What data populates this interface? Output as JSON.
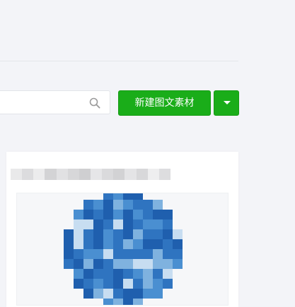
{
  "toolbar": {
    "search_value": "",
    "search_placeholder": "",
    "create_button_label": "新建图文素材",
    "dropdown_icon": "caret-down-icon",
    "search_icon": "magnifier-icon"
  },
  "colors": {
    "primary": "#1aad19",
    "page_background": "#f3f4f8",
    "card_background": "#ffffff",
    "mosaic_blues": [
      "#1f5fae",
      "#2f74c0",
      "#4a8fd1",
      "#7fb2df",
      "#c7ddf1"
    ]
  },
  "material_card": {
    "title_obscured": true,
    "cover_obscured": true
  }
}
